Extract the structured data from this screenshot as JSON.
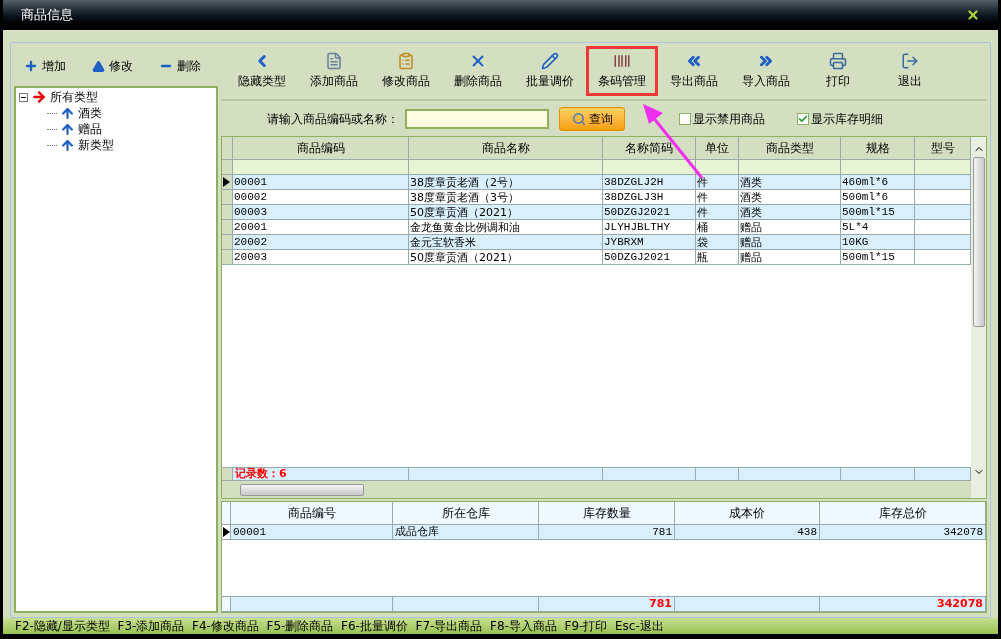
{
  "window": {
    "title": "商品信息"
  },
  "type_toolbar": [
    {
      "label": "增加",
      "kind": "plus"
    },
    {
      "label": "修改",
      "kind": "triangle"
    },
    {
      "label": "删除",
      "kind": "minus"
    }
  ],
  "type_tree": [
    {
      "label": "所有类型",
      "selected": true,
      "expanded": true,
      "children": [
        {
          "label": "酒类",
          "selected": false
        },
        {
          "label": "赠品",
          "selected": false
        },
        {
          "label": "新类型",
          "selected": false
        }
      ]
    }
  ],
  "toolbar": [
    {
      "label": "隐藏类型",
      "kind": "chevron-left",
      "highlighted": false
    },
    {
      "label": "添加商品",
      "kind": "document",
      "highlighted": false
    },
    {
      "label": "修改商品",
      "kind": "clipboard",
      "highlighted": false
    },
    {
      "label": "删除商品",
      "kind": "cross",
      "highlighted": false
    },
    {
      "label": "批量调价",
      "kind": "pencil",
      "highlighted": false
    },
    {
      "label": "条码管理",
      "kind": "barcode",
      "highlighted": true
    },
    {
      "label": "导出商品",
      "kind": "double-left",
      "highlighted": false
    },
    {
      "label": "导入商品",
      "kind": "double-right",
      "highlighted": false
    },
    {
      "label": "打印",
      "kind": "printer",
      "highlighted": false
    },
    {
      "label": "退出",
      "kind": "exit",
      "highlighted": false
    }
  ],
  "search": {
    "label": "请输入商品编码或名称：",
    "button": "查询"
  },
  "filters": [
    {
      "label": "显示禁用商品",
      "checked": false
    },
    {
      "label": "显示库存明细",
      "checked": true
    }
  ],
  "product_table": {
    "columns": [
      "商品编码",
      "商品名称",
      "名称简码",
      "单位",
      "商品类型",
      "规格",
      "型号"
    ],
    "rows": [
      {
        "selected": true,
        "cells": [
          "00001",
          "38度章贡老酒（2号）",
          "38DZGLJ2H",
          "件",
          "酒类",
          "460ml*6",
          null
        ]
      },
      {
        "selected": false,
        "cells": [
          "00002",
          "38度章贡老酒（3号）",
          "38DZGLJ3H",
          "件",
          "酒类",
          "500ml*6",
          null
        ]
      },
      {
        "selected": false,
        "cells": [
          "00003",
          "50度章贡酒（2021）",
          "50DZGJ2021",
          "件",
          "酒类",
          "500ml*15",
          null
        ]
      },
      {
        "selected": false,
        "cells": [
          "20001",
          "金龙鱼黄金比例调和油",
          "JLYHJBLTHY",
          "桶",
          "赠品",
          "5L*4",
          null
        ]
      },
      {
        "selected": false,
        "cells": [
          "20002",
          "金元宝软香米",
          "JYBRXM",
          "袋",
          "赠品",
          "10KG",
          null
        ]
      },
      {
        "selected": false,
        "cells": [
          "20003",
          "50度章贡酒（2021）",
          "50DZGJ2021",
          "瓶",
          "赠品",
          "500ml*15",
          null
        ]
      }
    ],
    "record_count": "记录数：6"
  },
  "stock_table": {
    "columns": [
      "商品编号",
      "所在仓库",
      "库存数量",
      "成本价",
      "库存总价"
    ],
    "rows": [
      {
        "selected": true,
        "cells": [
          "00001",
          "成品仓库",
          "781",
          "438",
          "342078"
        ]
      }
    ],
    "totals": {
      "stock_quantity": "781",
      "stock_value": "342078"
    }
  },
  "status_bar": "F2-隐藏/显示类型  F3-添加商品  F4-修改商品  F5-删除商品  F6-批量调价  F7-导出商品  F8-导入商品  F9-打印  Esc-退出"
}
